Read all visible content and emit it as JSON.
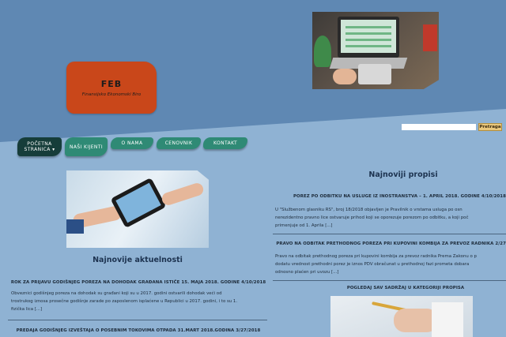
{
  "logo": {
    "title": "FEB",
    "subtitle": "Finansijsko Ekonomski Biro"
  },
  "search": {
    "placeholder": "",
    "button_label": "Pretraga"
  },
  "nav": {
    "items": [
      {
        "label": "POČETNA STRANICA ▾"
      },
      {
        "label": "NAŠI KIJENTI"
      },
      {
        "label": "O NAMA"
      },
      {
        "label": "CENOVNIK"
      },
      {
        "label": "KONTAKT"
      }
    ]
  },
  "left": {
    "heading": "Najnovije aktuelnosti",
    "news": [
      {
        "title": "ROK ZA PRIJAVU GODIŠNJEG POREZA NA DOHODAK GRAĐANA ISTIČE 15. MAJA 2018. GODINE 4/10/2018",
        "lines": [
          "Obveznici godišnjeg poreza na dohodak su građani koji su u 2017. godini ostvarili dohodak veći od",
          "trostrukog iznosa prosečne godišnje zarade po zaposlenom isplaćene u Republici u 2017. godini, i to su 1.",
          "fizička lica [...]"
        ]
      },
      {
        "title": "PREDAJA GODIŠNJEG IZVEŠTAJA O POSEBNIM TOKOVIMA OTPADA 31.MART 2018.GODINA 3/27/2018",
        "lines": []
      }
    ]
  },
  "right": {
    "heading": "Najnoviji propisi",
    "news": [
      {
        "title": "POREZ PO ODBITKU NA USLUGE IZ INOSTRANSTVA – 1. APRIL 2018. GODINE 4/10/2018",
        "lines": [
          "U \"Službenom glasniku RS\", broj 18/2018 objavljen je Pravilnik o vrstama usluga po osn",
          "nerezidentno pravno lice ostvaruje prihod koji se oporezuje porezom po odbitku, a koji poč",
          "primenjuje od 1. Aprila [...]"
        ]
      },
      {
        "title": "PRAVO NA ODBITAK PRETHODNOG POREZA PRI KUPOVINI KOMBIJA ZA PREVOZ RADNIKA 2/27",
        "lines": [
          "Pravo na odbitak prethodnog poreza pri kupovini kombija za prevoz radnika Prema Zakonu o p",
          "dodatu vrednost prethodni porez je iznos PDV obračunat u prethodnoj fazi prometa dobara",
          "odnosno plaćen pri uvozu [...]"
        ]
      }
    ],
    "view_all": "POGLEDAJ SAV SADRŽAJ U KATEGORIJI PROPISA"
  }
}
